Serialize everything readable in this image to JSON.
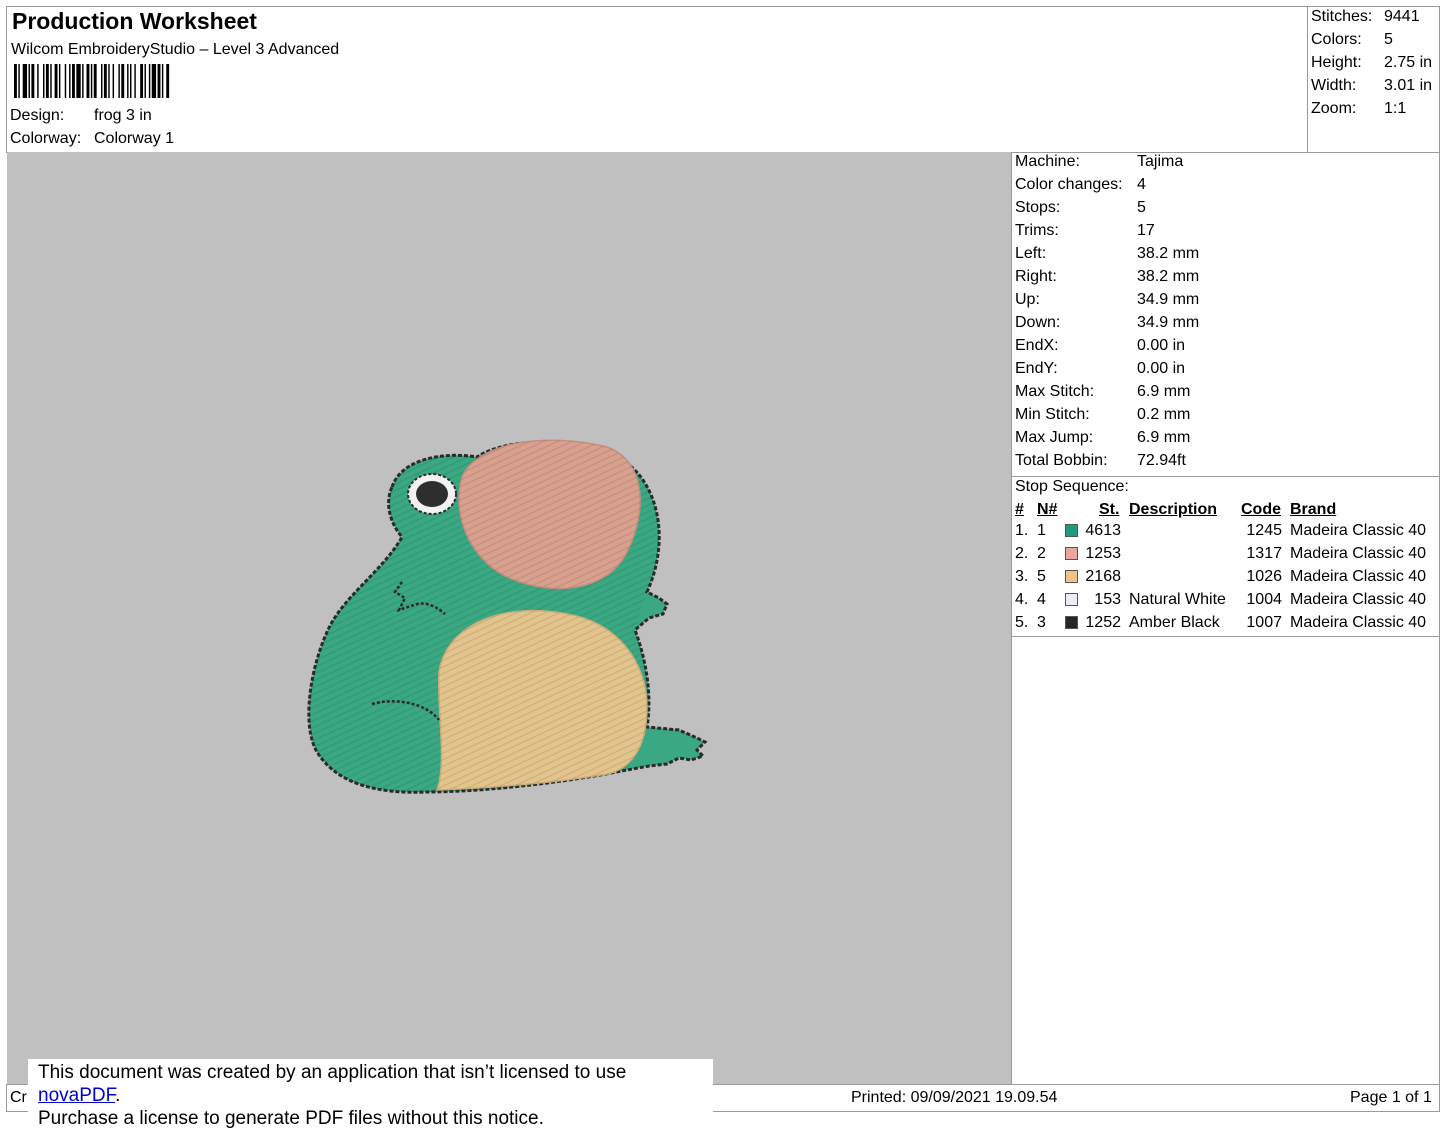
{
  "header": {
    "title": "Production Worksheet",
    "subtitle": "Wilcom EmbroideryStudio – Level 3 Advanced",
    "design_label": "Design:",
    "design_value": "frog 3 in",
    "colorway_label": "Colorway:",
    "colorway_value": "Colorway 1"
  },
  "summary": {
    "stitches_label": "Stitches:",
    "stitches_value": "9441",
    "colors_label": "Colors:",
    "colors_value": "5",
    "height_label": "Height:",
    "height_value": "2.75 in",
    "width_label": "Width:",
    "width_value": "3.01 in",
    "zoom_label": "Zoom:",
    "zoom_value": "1:1"
  },
  "machine_info": [
    {
      "label": "Machine:",
      "value": "Tajima"
    },
    {
      "label": "Color changes:",
      "value": "4"
    },
    {
      "label": "Stops:",
      "value": "5"
    },
    {
      "label": "Trims:",
      "value": "17"
    },
    {
      "label": "Left:",
      "value": "38.2 mm"
    },
    {
      "label": "Right:",
      "value": "38.2 mm"
    },
    {
      "label": "Up:",
      "value": "34.9 mm"
    },
    {
      "label": "Down:",
      "value": "34.9 mm"
    },
    {
      "label": "EndX:",
      "value": "0.00 in"
    },
    {
      "label": "EndY:",
      "value": "0.00 in"
    },
    {
      "label": "Max Stitch:",
      "value": "6.9 mm"
    },
    {
      "label": "Min Stitch:",
      "value": "0.2 mm"
    },
    {
      "label": "Max Jump:",
      "value": "6.9 mm"
    },
    {
      "label": "Total Bobbin:",
      "value": "72.94ft"
    }
  ],
  "stop_sequence": {
    "title": "Stop Sequence:",
    "columns": {
      "num": "#",
      "n": "N#",
      "st": "St.",
      "desc": "Description",
      "code": "Code",
      "brand": "Brand"
    },
    "rows": [
      {
        "num": "1.",
        "n": "1",
        "color": "#1f9a7a",
        "st": "4613",
        "desc": "",
        "code": "1245",
        "brand": "Madeira Classic 40"
      },
      {
        "num": "2.",
        "n": "2",
        "color": "#e8a7a0",
        "st": "1253",
        "desc": "",
        "code": "1317",
        "brand": "Madeira Classic 40"
      },
      {
        "num": "3.",
        "n": "5",
        "color": "#f6c08c",
        "st": "2168",
        "desc": "",
        "code": "1026",
        "brand": "Madeira Classic 40"
      },
      {
        "num": "4.",
        "n": "4",
        "color": "#ececf2",
        "st": "153",
        "desc": "Natural White",
        "code": "1004",
        "brand": "Madeira Classic 40"
      },
      {
        "num": "5.",
        "n": "3",
        "color": "#262626",
        "st": "1252",
        "desc": "Amber Black",
        "code": "1007",
        "brand": "Madeira Classic 40"
      }
    ]
  },
  "footer": {
    "left_fragment": "Cr",
    "printed": "Printed: 09/09/2021 19.09.54",
    "page": "Page 1 of 1"
  },
  "notice": {
    "line1_prefix": "This document was created by an application that isn’t licensed to use ",
    "line1_link": "novaPDF",
    "line1_suffix": ".",
    "line2": "Purchase a license to generate PDF files without this notice."
  },
  "colors": {
    "canvas_bg": "#c0c0c0",
    "frog_green": "#3aa882",
    "frog_cheek": "#d9a08e",
    "frog_belly": "#e3c48c",
    "outline": "#2a2a2a"
  }
}
